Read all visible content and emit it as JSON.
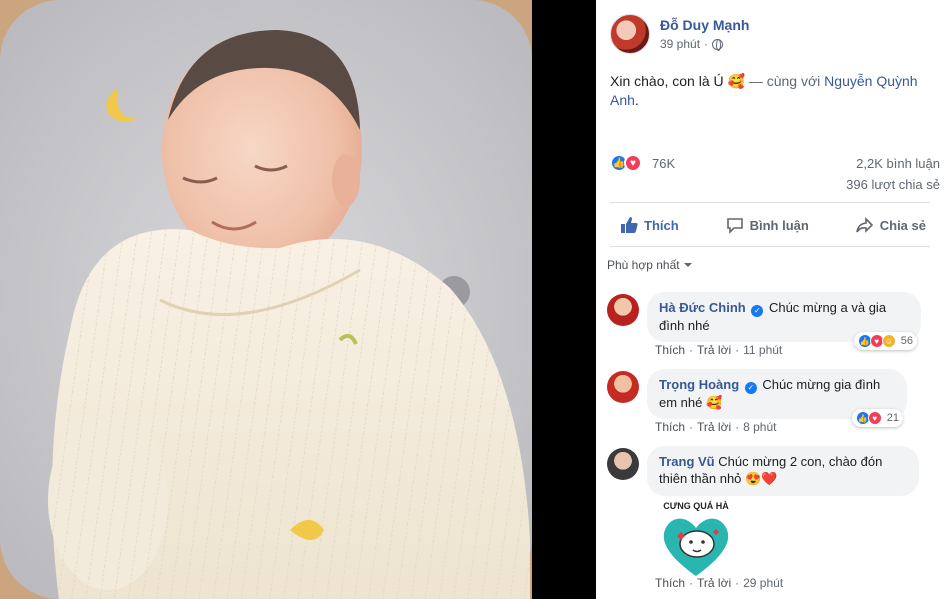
{
  "post": {
    "author": "Đỗ Duy Mạnh",
    "time": "39 phút",
    "caption_text": "Xin chào, con là Ú 🥰",
    "caption_with": " — cùng với ",
    "caption_tagged": "Nguyễn Quỳnh Anh",
    "caption_end": ".",
    "reactions_count": "76K",
    "comments_count": "2,2K bình luận",
    "shares_count": "396 lượt chia sẻ"
  },
  "actions": {
    "like": "Thích",
    "comment": "Bình luận",
    "share": "Chia sẻ"
  },
  "sort_label": "Phù hợp nhất",
  "comments": [
    {
      "name": "Hà Đức Chinh",
      "text": "Chúc mừng a và gia đình nhé",
      "like": "Thích",
      "reply": "Trả lời",
      "time": "11 phút",
      "reactions": "56"
    },
    {
      "name": "Trọng Hoàng",
      "text": "Chúc mừng gia đình em nhé 🥰",
      "like": "Thích",
      "reply": "Trả lời",
      "time": "8 phút",
      "reactions": "21"
    },
    {
      "name": "Trang Vũ",
      "text": "Chúc mừng 2 con, chào đón thiên thần nhỏ 😍❤️",
      "like": "Thích",
      "reply": "Trả lời",
      "time": "29 phút"
    }
  ],
  "sticker_text": "CƯNG QUÁ HÀ",
  "colors": {
    "link": "#385898",
    "like_blue": "#1877f2",
    "love_red": "#f33e58",
    "bubble_bg": "#f2f3f5"
  },
  "icons": [
    "globe-icon",
    "like-icon",
    "love-icon",
    "comment-icon",
    "share-icon",
    "verified-icon",
    "caret-down-icon"
  ]
}
